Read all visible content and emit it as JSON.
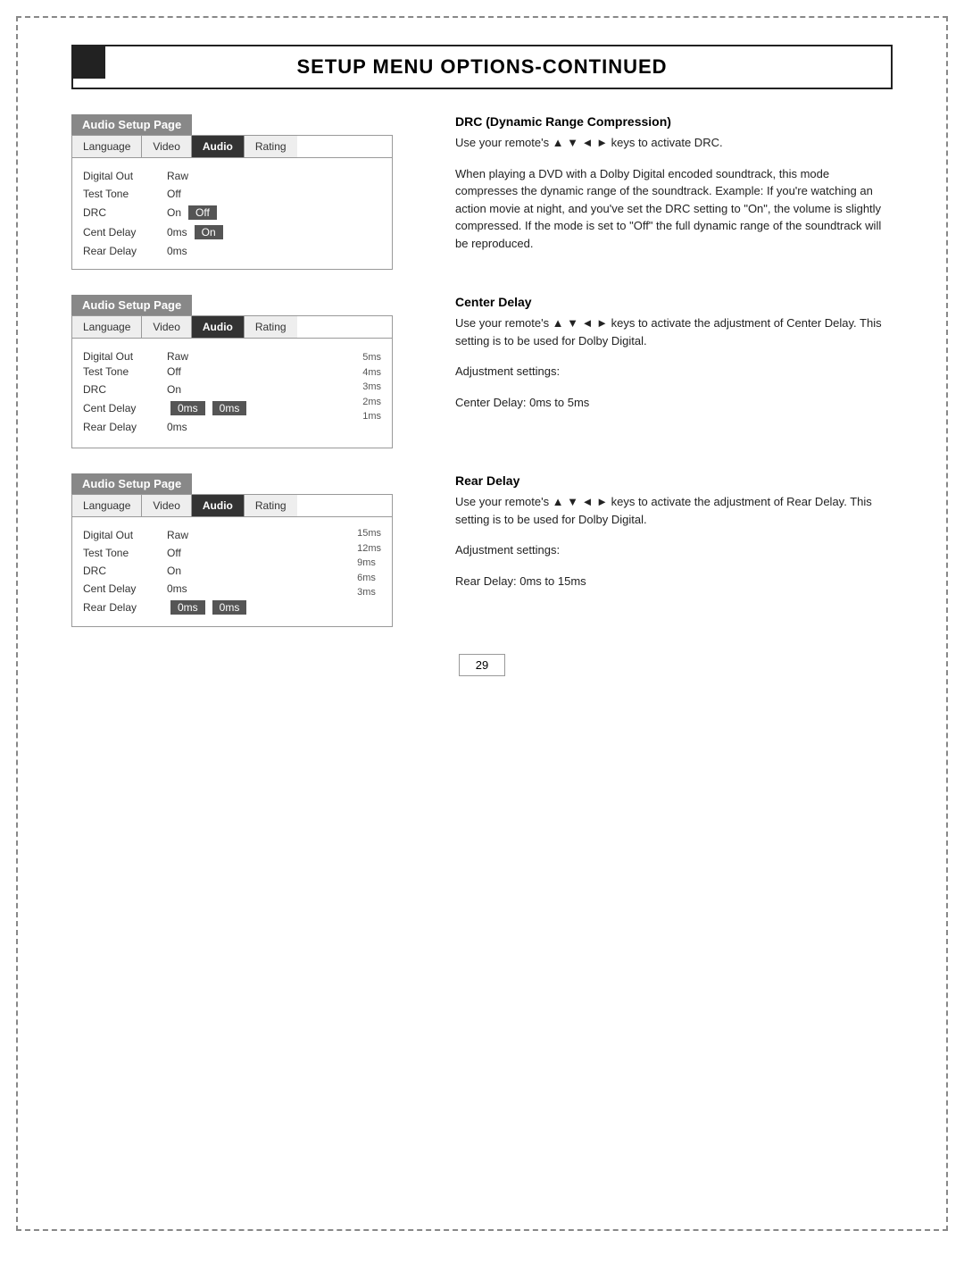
{
  "page": {
    "title": "SETUP MENU OPTIONS-CONTINUED",
    "page_number": "29"
  },
  "sections": [
    {
      "id": "section1",
      "header": "Audio Setup Page",
      "tabs": [
        "Language",
        "Video",
        "Audio",
        "Rating"
      ],
      "active_tab": "Audio",
      "rows": [
        {
          "label": "Digital Out",
          "value": "Raw",
          "highlight": null
        },
        {
          "label": "Test Tone",
          "value": "Off",
          "highlight": null
        },
        {
          "label": "DRC",
          "value": "On",
          "highlight": "Off",
          "highlight2": "On"
        },
        {
          "label": "Cent Delay",
          "value": "0ms",
          "highlight": null
        },
        {
          "label": "Rear Delay",
          "value": "0ms",
          "highlight": null
        }
      ],
      "description": {
        "title": "DRC (Dynamic Range Compression)",
        "paragraphs": [
          "Use your remote's ▲ ▼ ◄ ► keys to activate DRC.",
          "When playing a DVD with a Dolby Digital encoded soundtrack, this mode compresses the dynamic range of the soundtrack. Example: If you're watching an action movie at night, and you've set the DRC setting to \"On\", the volume is slightly compressed.  If the mode is set to \"Off\" the full dynamic range of the soundtrack will be reproduced."
        ]
      }
    },
    {
      "id": "section2",
      "header": "Audio Setup Page",
      "tabs": [
        "Language",
        "Video",
        "Audio",
        "Rating"
      ],
      "active_tab": "Audio",
      "rows": [
        {
          "label": "Digital Out",
          "value": "Raw",
          "highlight": null,
          "dropdown": [
            "5ms",
            "4ms",
            "3ms",
            "2ms",
            "1ms"
          ]
        },
        {
          "label": "Test Tone",
          "value": "Off",
          "highlight": null
        },
        {
          "label": "DRC",
          "value": "On",
          "highlight": null
        },
        {
          "label": "Cent Delay",
          "value": "0ms",
          "highlight": "0ms"
        },
        {
          "label": "Rear Delay",
          "value": "0ms",
          "highlight": null
        }
      ],
      "description": {
        "title": "Center Delay",
        "paragraphs": [
          "Use your remote's ▲ ▼ ◄ ► keys to activate the adjustment of Center Delay.  This setting is to be used for Dolby Digital.",
          "Adjustment settings:",
          "Center Delay: 0ms to 5ms"
        ]
      }
    },
    {
      "id": "section3",
      "header": "Audio Setup Page",
      "tabs": [
        "Language",
        "Video",
        "Audio",
        "Rating"
      ],
      "active_tab": "Audio",
      "rows": [
        {
          "label": "Digital Out",
          "value": "Raw",
          "highlight": null,
          "dropdown": [
            "15ms",
            "12ms",
            "9ms",
            "6ms",
            "3ms"
          ]
        },
        {
          "label": "Test Tone",
          "value": "Off",
          "highlight": null
        },
        {
          "label": "DRC",
          "value": "On",
          "highlight": null
        },
        {
          "label": "Cent Delay",
          "value": "0ms",
          "highlight": null
        },
        {
          "label": "Rear Delay",
          "value": "0ms",
          "highlight": "0ms"
        }
      ],
      "description": {
        "title": "Rear Delay",
        "paragraphs": [
          "Use your remote's ▲ ▼ ◄ ► keys to activate the adjustment of Rear Delay.  This setting is to be used for Dolby Digital.",
          "Adjustment settings:",
          "Rear Delay:   0ms to 15ms"
        ]
      }
    }
  ]
}
